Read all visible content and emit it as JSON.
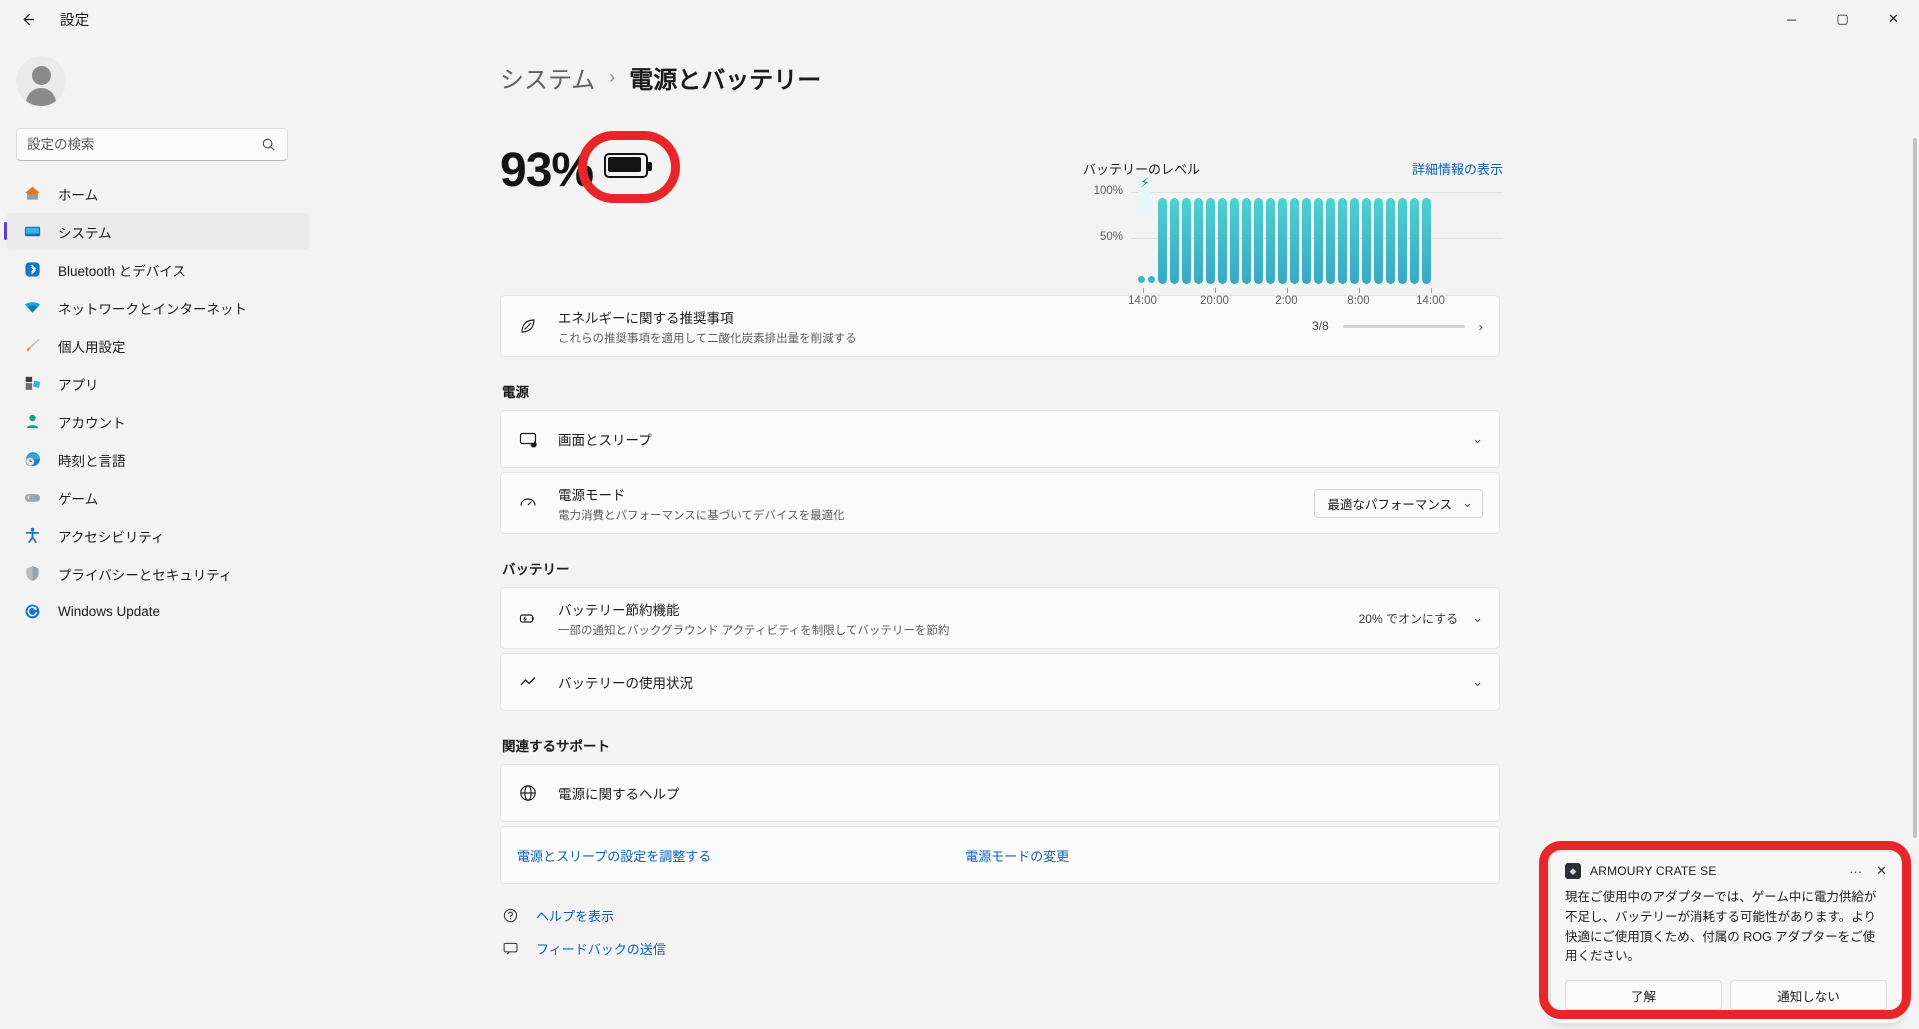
{
  "titlebar": {
    "back_icon": "back-arrow-icon",
    "title": "設定",
    "minimize": "─",
    "maximize": "▢",
    "close": "✕"
  },
  "sidebar": {
    "search": {
      "placeholder": "設定の検索",
      "value": "",
      "icon": "search-icon"
    },
    "items": [
      {
        "label": "ホーム",
        "icon": "home-icon",
        "active": false
      },
      {
        "label": "システム",
        "icon": "system-icon",
        "active": true
      },
      {
        "label": "Bluetooth とデバイス",
        "icon": "bluetooth-icon",
        "active": false
      },
      {
        "label": "ネットワークとインターネット",
        "icon": "network-icon",
        "active": false
      },
      {
        "label": "個人用設定",
        "icon": "personalization-icon",
        "active": false
      },
      {
        "label": "アプリ",
        "icon": "apps-icon",
        "active": false
      },
      {
        "label": "アカウント",
        "icon": "accounts-icon",
        "active": false
      },
      {
        "label": "時刻と言語",
        "icon": "time-language-icon",
        "active": false
      },
      {
        "label": "ゲーム",
        "icon": "gaming-icon",
        "active": false
      },
      {
        "label": "アクセシビリティ",
        "icon": "accessibility-icon",
        "active": false
      },
      {
        "label": "プライバシーとセキュリティ",
        "icon": "privacy-shield-icon",
        "active": false
      },
      {
        "label": "Windows Update",
        "icon": "windows-update-icon",
        "active": false
      }
    ]
  },
  "breadcrumb": {
    "parent": "システム",
    "separator": "›",
    "current": "電源とバッテリー"
  },
  "hero": {
    "battery_percent": "93%",
    "battery_icon": "battery-full-icon"
  },
  "chart_data": {
    "type": "bar",
    "title": "バッテリーのレベル",
    "link_label": "詳細情報の表示",
    "ylabel": "",
    "xlabel": "",
    "ylim": [
      0,
      100
    ],
    "ytick_labels": [
      "100%",
      "50%"
    ],
    "ytick_values": [
      100,
      50
    ],
    "xtick_labels": [
      "14:00",
      "20:00",
      "2:00",
      "8:00",
      "14:00"
    ],
    "grid": true,
    "legend_position": "none",
    "annotation": "charging-start-bolt",
    "categories": [
      "14:00",
      "15:00",
      "16:00",
      "17:00",
      "18:00",
      "19:00",
      "20:00",
      "21:00",
      "22:00",
      "23:00",
      "0:00",
      "1:00",
      "2:00",
      "3:00",
      "4:00",
      "5:00",
      "6:00",
      "7:00",
      "8:00",
      "9:00",
      "10:00",
      "11:00",
      "12:00",
      "13:00",
      "14:00"
    ],
    "values": [
      4,
      4,
      93,
      93,
      93,
      93,
      93,
      93,
      93,
      93,
      93,
      93,
      93,
      93,
      93,
      93,
      93,
      93,
      93,
      93,
      93,
      93,
      93,
      93,
      93
    ]
  },
  "energy_card": {
    "icon": "energy-leaf-icon",
    "title": "エネルギーに関する推奨事項",
    "subtitle": "これらの推奨事項を適用して二酸化炭素排出量を削減する",
    "progress_label": "3/8",
    "progress_percent": 37.5,
    "chevron": "›"
  },
  "power_section": {
    "heading": "電源",
    "rows": [
      {
        "icon": "screen-sleep-icon",
        "title": "画面とスリープ",
        "subtitle": "",
        "chevron": "⌄"
      },
      {
        "icon": "power-mode-icon",
        "title": "電源モード",
        "subtitle": "電力消費とパフォーマンスに基づいてデバイスを最適化",
        "value": "最適なパフォーマンス",
        "chevron": "⌄"
      }
    ]
  },
  "battery_section": {
    "heading": "バッテリー",
    "rows": [
      {
        "icon": "battery-saver-icon",
        "title": "バッテリー節約機能",
        "subtitle": "一部の通知とバックグラウンド アクティビティを制限してバッテリーを節約",
        "value": "20% でオンにする",
        "chevron": "⌄"
      },
      {
        "icon": "battery-usage-icon",
        "title": "バッテリーの使用状況",
        "subtitle": "",
        "chevron": "⌄"
      }
    ]
  },
  "support_section": {
    "heading": "関連するサポート",
    "help_row": {
      "icon": "globe-help-icon",
      "title": "電源に関するヘルプ"
    },
    "links": [
      {
        "label": "電源とスリープの設定を調整する"
      },
      {
        "label": "電源モードの変更"
      }
    ]
  },
  "footer": {
    "links": [
      {
        "icon": "help-icon",
        "label": "ヘルプを表示"
      },
      {
        "icon": "feedback-icon",
        "label": "フィードバックの送信"
      }
    ]
  },
  "toast": {
    "app_name": "ARMOURY CRATE SE",
    "app_icon": "armoury-crate-icon",
    "more_icon": "···",
    "close_icon": "✕",
    "message": "現在ご使用中のアダプターでは、ゲーム中に電力供給が不足し、バッテリーが消耗する可能性があります。より快適にご使用頂くため、付属の ROG アダプターをご使用ください。",
    "primary_button": "了解",
    "secondary_button": "通知しない"
  },
  "colors": {
    "annotation_red": "#e8262a",
    "accent_purple": "#6a35cc",
    "link_blue": "#0f5fbd",
    "chart_teal": "#3bb6c8"
  }
}
